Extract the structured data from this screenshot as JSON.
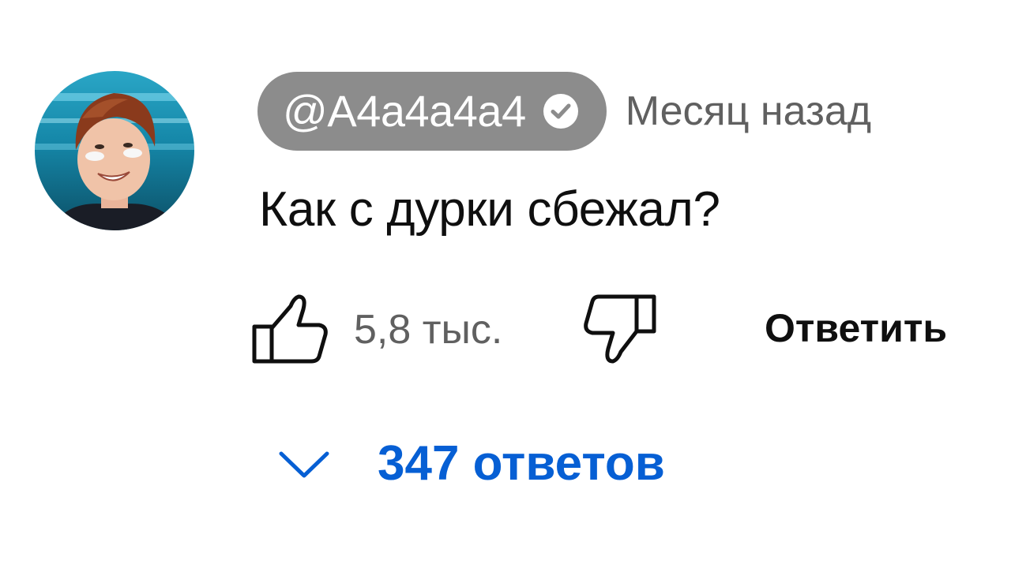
{
  "comment": {
    "author": "@A4a4a4a4",
    "verified_icon": "verified-checkmark-icon",
    "time": "Месяц назад",
    "text": "Как с дурки сбежал?",
    "avatar": "user-avatar-photo"
  },
  "actions": {
    "like_icon": "thumb-up-icon",
    "like_count": "5,8 тыс.",
    "dislike_icon": "thumb-down-icon",
    "reply_label": "Ответить"
  },
  "replies": {
    "icon": "chevron-down-icon",
    "label": "347 ответов"
  },
  "colors": {
    "author_chip_bg": "#8c8c8c",
    "secondary_text": "#606060",
    "link_blue": "#065fd4",
    "primary_text": "#0f0f0f"
  }
}
